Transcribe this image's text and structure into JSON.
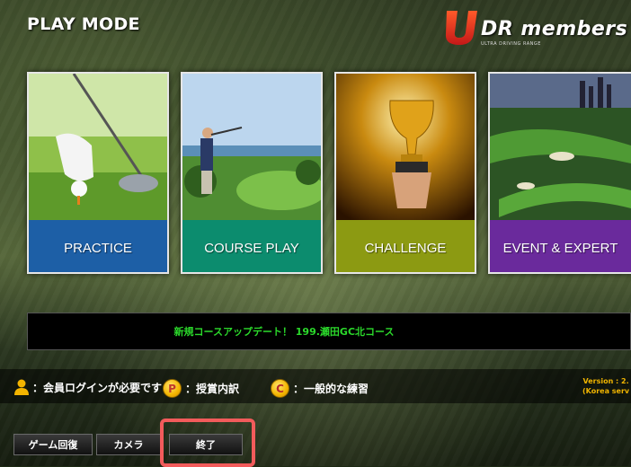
{
  "header": {
    "title": "PLAY MODE"
  },
  "logo": {
    "text": "DR members",
    "subtitle": "ULTRA DRIVING RANGE"
  },
  "modes": [
    {
      "label": "PRACTICE",
      "color": "#1d5fa6"
    },
    {
      "label": "COURSE PLAY",
      "color": "#0c8c6e"
    },
    {
      "label": "CHALLENGE",
      "color": "#8c9a12"
    },
    {
      "label": "EVENT & EXPERT",
      "color": "#6a2a9c"
    }
  ],
  "ticker": {
    "text": "新規コースアップデート！ 199.瀬田GC北コース",
    "color": "#2bd92b"
  },
  "legend": {
    "member": "：会員ログインが必要です",
    "prize_icon": "P",
    "prize": "：授賞内訳",
    "general_icon": "C",
    "general": "：一般的な練習"
  },
  "version": {
    "line1": "Version : 2.",
    "line2": "(Korea serv"
  },
  "buttons": {
    "resume": "ゲーム回復",
    "camera": "カメラ",
    "exit": "終了"
  },
  "colors": {
    "accent": "#f3b400",
    "highlight": "#f25b5b"
  }
}
